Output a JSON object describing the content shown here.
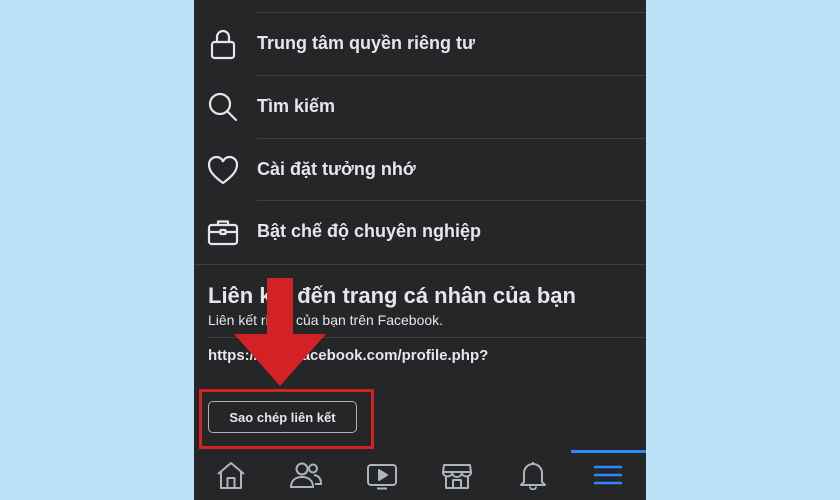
{
  "menu": {
    "items": [
      {
        "label": "Trung tâm quyền riêng tư",
        "icon": "lock-icon"
      },
      {
        "label": "Tìm kiếm",
        "icon": "search-icon"
      },
      {
        "label": "Cài đặt tưởng nhớ",
        "icon": "heart-icon"
      },
      {
        "label": "Bật chế độ chuyên nghiệp",
        "icon": "briefcase-icon"
      }
    ]
  },
  "profile_link": {
    "title": "Liên kết đến trang cá nhân của bạn",
    "subtitle": "Liên kết riêng của bạn trên Facebook.",
    "url": "https://www.facebook.com/profile.php?",
    "copy_button": "Sao chép liên kết"
  },
  "bottom_nav": {
    "items": [
      {
        "icon": "home-icon"
      },
      {
        "icon": "friends-icon"
      },
      {
        "icon": "video-icon"
      },
      {
        "icon": "marketplace-icon"
      },
      {
        "icon": "bell-icon"
      },
      {
        "icon": "menu-icon",
        "active": true
      }
    ]
  },
  "colors": {
    "background": "#b9e2f9",
    "surface": "#252627",
    "text": "#e4e6eb",
    "accent": "#2e89ff",
    "annotation": "#d42125"
  }
}
